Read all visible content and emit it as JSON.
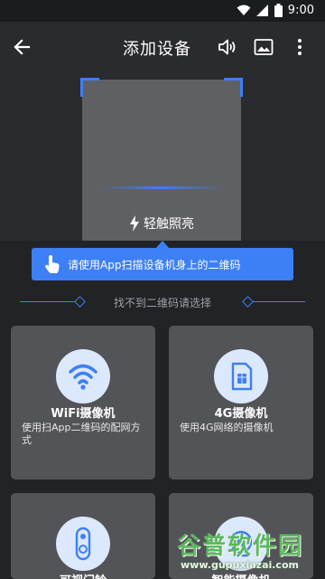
{
  "status_bar": {
    "time": "9:00"
  },
  "header": {
    "title": "添加设备"
  },
  "scanner": {
    "flash_label": "轻触照亮"
  },
  "tip": {
    "text": "请使用App扫描设备机身上的二维码"
  },
  "divider": {
    "text": "找不到二维码请选择"
  },
  "cards": [
    {
      "title": "WiFi摄像机",
      "desc": "使用扫App二维码的配网方式"
    },
    {
      "title": "4G摄像机",
      "desc": "使用4G网络的摄像机"
    },
    {
      "title": "可视门铃",
      "desc": ""
    },
    {
      "title": "智能摄像机",
      "desc": ""
    }
  ],
  "watermark": {
    "text": "谷普软件园",
    "url": "www.gupuxiazai.com"
  },
  "colors": {
    "accent": "#3d7ff5",
    "background": "#222326",
    "card": "#535458"
  }
}
